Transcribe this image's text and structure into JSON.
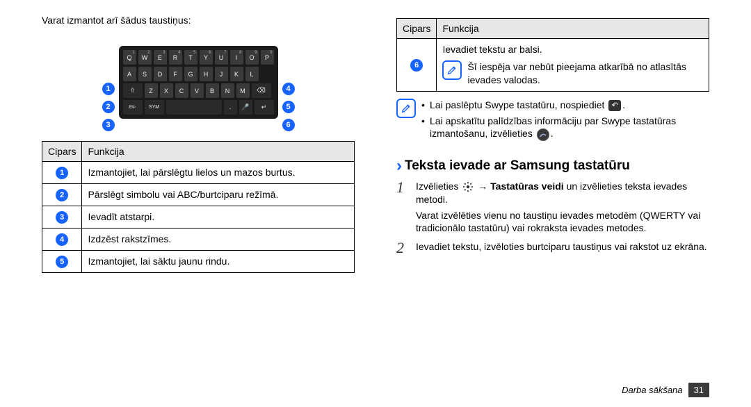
{
  "left": {
    "intro": "Varat izmantot arī šādus taustiņus:",
    "table_head": {
      "c1": "Cipars",
      "c2": "Funkcija"
    },
    "rows": [
      {
        "n": "1",
        "text": "Izmantojiet, lai pārslēgtu lielos un mazos burtus."
      },
      {
        "n": "2",
        "text": "Pārslēgt simbolu vai ABC/burtciparu režīmā."
      },
      {
        "n": "3",
        "text": "Ievadīt atstarpi."
      },
      {
        "n": "4",
        "text": "Izdzēst rakstzīmes."
      },
      {
        "n": "5",
        "text": "Izmantojiet, lai sāktu jaunu rindu."
      }
    ],
    "badges_left": [
      "1",
      "2",
      "3"
    ],
    "badges_right": [
      "4",
      "5",
      "6"
    ]
  },
  "right": {
    "cont_head": {
      "c1": "Cipars",
      "c2": "Funkcija"
    },
    "cont_row": {
      "n": "6",
      "line1": "Ievadiet tekstu ar balsi.",
      "note": "Šī iespēja var nebūt pieejama atkarībā no atlasītās ievades valodas."
    },
    "tips": {
      "li1_a": "Lai paslēptu Swype tastatūru, nospiediet ",
      "li1_b": ".",
      "li2_a": "Lai apskatītu palīdzības informāciju par Swype tastatūras izmantošanu, izvēlieties ",
      "li2_b": "."
    },
    "section_title": "Teksta ievade ar Samsung tastatūru",
    "step1": {
      "a": "Izvēlieties ",
      "b": " → ",
      "bold": "Tastatūras veidi",
      "c": " un izvēlieties teksta ievades metodi.",
      "sub": "Varat izvēlēties vienu no taustiņu ievades metodēm (QWERTY vai tradicionālo tastatūru) vai rokraksta ievades metodes."
    },
    "step2": "Ievadiet tekstu, izvēloties burtciparu taustiņus vai rakstot uz ekrāna."
  },
  "footer": {
    "label": "Darba sākšana",
    "page": "31"
  }
}
